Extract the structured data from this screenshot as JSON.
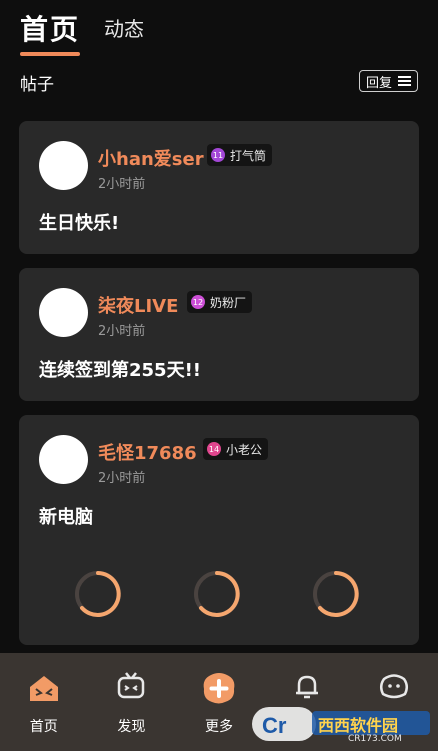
{
  "header": {
    "tab_home": "首页",
    "tab_dynamic": "动态",
    "section_title": "帖子",
    "reply_label": "回复"
  },
  "posts": [
    {
      "username": "小han爱ser",
      "level": "11",
      "level_color": "#a347d6",
      "badge": "打气筒",
      "time": "2小时前",
      "content": "生日快乐!"
    },
    {
      "username": "柒夜LIVE",
      "level": "12",
      "level_color": "#cc4fd6",
      "badge": "奶粉厂",
      "time": "2小时前",
      "content": "连续签到第255天!!"
    },
    {
      "username": "毛怪17686",
      "level": "14",
      "level_color": "#e0468e",
      "badge": "小老公",
      "time": "2小时前",
      "content": "新电脑"
    }
  ],
  "nav": {
    "items": [
      {
        "label": "首页",
        "icon": "home-icon"
      },
      {
        "label": "发现",
        "icon": "tv-icon"
      },
      {
        "label": "更多",
        "icon": "plus-icon"
      },
      {
        "label": "",
        "icon": "bell-icon"
      },
      {
        "label": "",
        "icon": "face-icon"
      }
    ]
  },
  "watermark": {
    "logo_text": "Cr",
    "brand": "西西软件园",
    "url": "CR173.COM"
  },
  "colors": {
    "accent": "#f08a5a",
    "card": "#292929",
    "nav_bg": "#3a3531",
    "loader": "#f5a66e"
  }
}
